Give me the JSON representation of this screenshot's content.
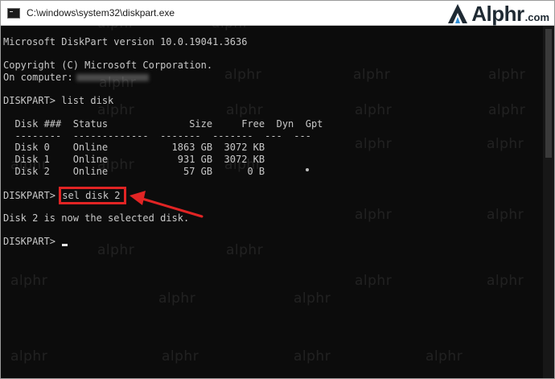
{
  "window": {
    "title": "C:\\windows\\system32\\diskpart.exe"
  },
  "brand": {
    "name": "Alphr",
    "tld": ".com",
    "watermark_text": "alphr"
  },
  "console": {
    "version_line": "Microsoft DiskPart version 10.0.19041.3636",
    "copyright_line": "Copyright (C) Microsoft Corporation.",
    "computer_label": "On computer:",
    "prompt1": "DISKPART> ",
    "command1": "list disk",
    "table": {
      "headers": [
        "Disk ###",
        "Status",
        "Size",
        "Free",
        "Dyn",
        "Gpt"
      ],
      "rows": [
        [
          "Disk 0",
          "Online",
          "1863 GB",
          "3072 KB",
          "",
          ""
        ],
        [
          "Disk 1",
          "Online",
          "931 GB",
          "3072 KB",
          "",
          ""
        ],
        [
          "Disk 2",
          "Online",
          "57 GB",
          "0 B",
          "",
          ""
        ]
      ]
    },
    "prompt2": "DISKPART> ",
    "command2": "sel disk 2",
    "result_line": "Disk 2 is now the selected disk.",
    "prompt3": "DISKPART> "
  },
  "colors": {
    "console_bg": "#0c0c0c",
    "console_text": "#c8c8c8",
    "highlight": "#e12424"
  }
}
